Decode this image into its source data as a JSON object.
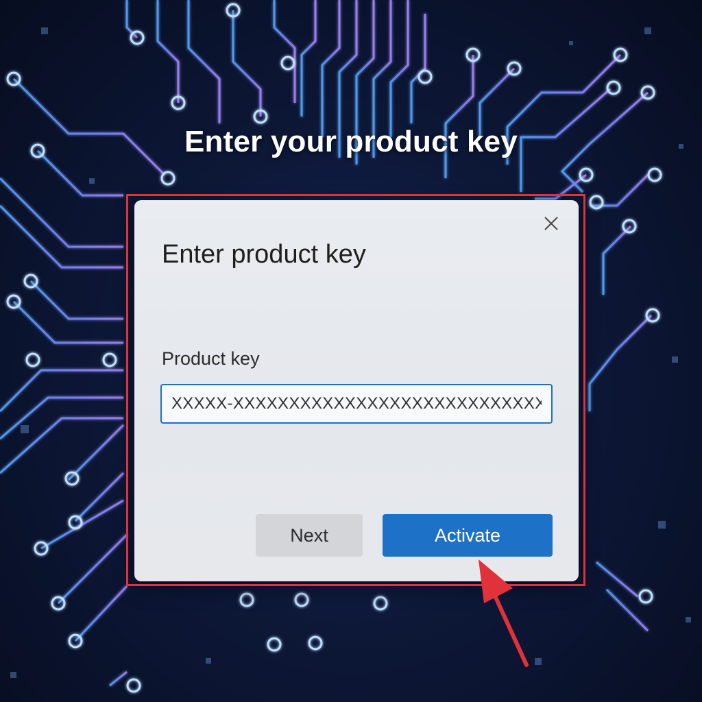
{
  "page": {
    "headline": "Enter your product key"
  },
  "dialog": {
    "title": "Enter product key",
    "close_icon": "close-icon",
    "field_label": "Product key",
    "key_value": "XXXXX-XXXXXXXXXXXXXXXXXXXXXXXXXXXXX",
    "next_label": "Next",
    "activate_label": "Activate"
  },
  "colors": {
    "background": "#0d1838",
    "circuit_line": "#6f8dff",
    "highlight_border": "#e0323a",
    "activate_button": "#1d72c7",
    "next_button": "#d3d5d9",
    "input_border": "#1f6fc4",
    "annotation_arrow": "#e0323a"
  },
  "annotation": {
    "highlight": "red-outline-box",
    "pointer": "red-arrow-icon"
  }
}
